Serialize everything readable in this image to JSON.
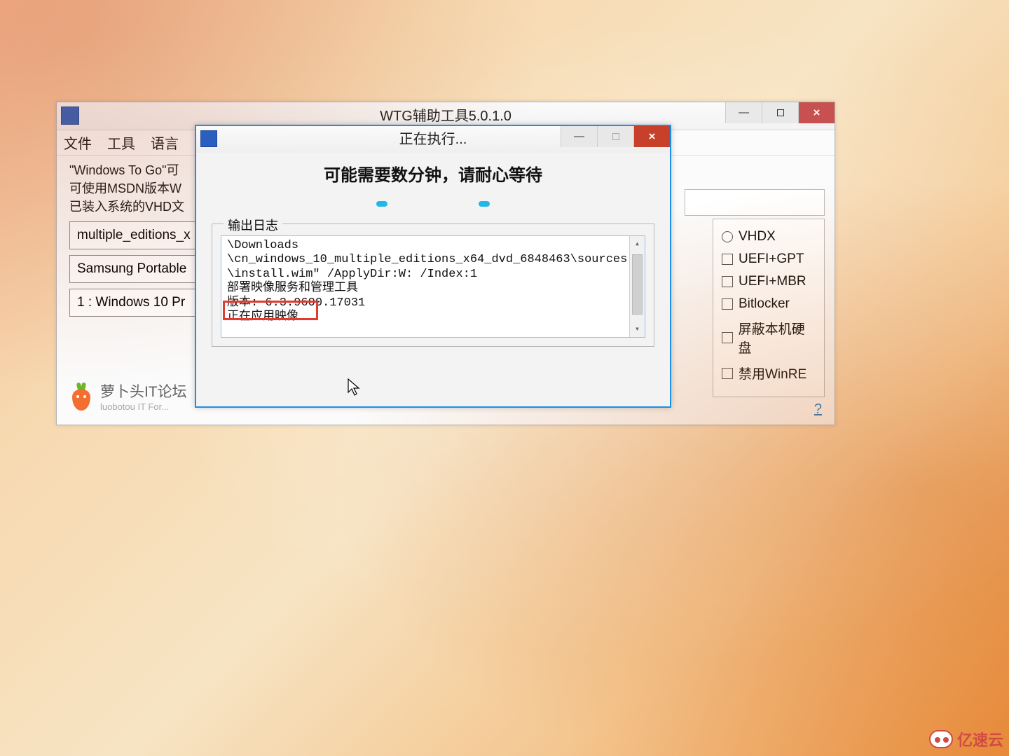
{
  "main_window": {
    "title": "WTG辅助工具5.0.1.0",
    "menu": {
      "file": "文件",
      "tools": "工具",
      "language": "语言"
    },
    "info_line1": "\"Windows To Go\"可",
    "info_line2": "可使用MSDN版本W",
    "info_line3": "已装入系统的VHD文",
    "field_image": "multiple_editions_x",
    "field_drive": "Samsung Portable",
    "field_edition": "1 : Windows 10 Pr",
    "forum": {
      "name": "萝卜头IT论坛",
      "sub": "luobotou IT For..."
    },
    "right_panel": {
      "vhdx": "VHDX",
      "uefi_gpt": "UEFI+GPT",
      "uefi_mbr": "UEFI+MBR",
      "bitlocker": "Bitlocker",
      "block_disk": "屏蔽本机硬盘",
      "disable_winre": "禁用WinRE",
      "help": "?"
    }
  },
  "dialog": {
    "title": "正在执行...",
    "heading": "可能需要数分钟，请耐心等待",
    "log_label": "输出日志",
    "log_lines": [
      "\\Downloads",
      "\\cn_windows_10_multiple_editions_x64_dvd_6848463\\sources",
      "\\install.wim\" /ApplyDir:W: /Index:1",
      "部署映像服务和管理工具",
      "版本: 6.3.9600.17031",
      "正在应用映像"
    ]
  },
  "watermark": "亿速云"
}
